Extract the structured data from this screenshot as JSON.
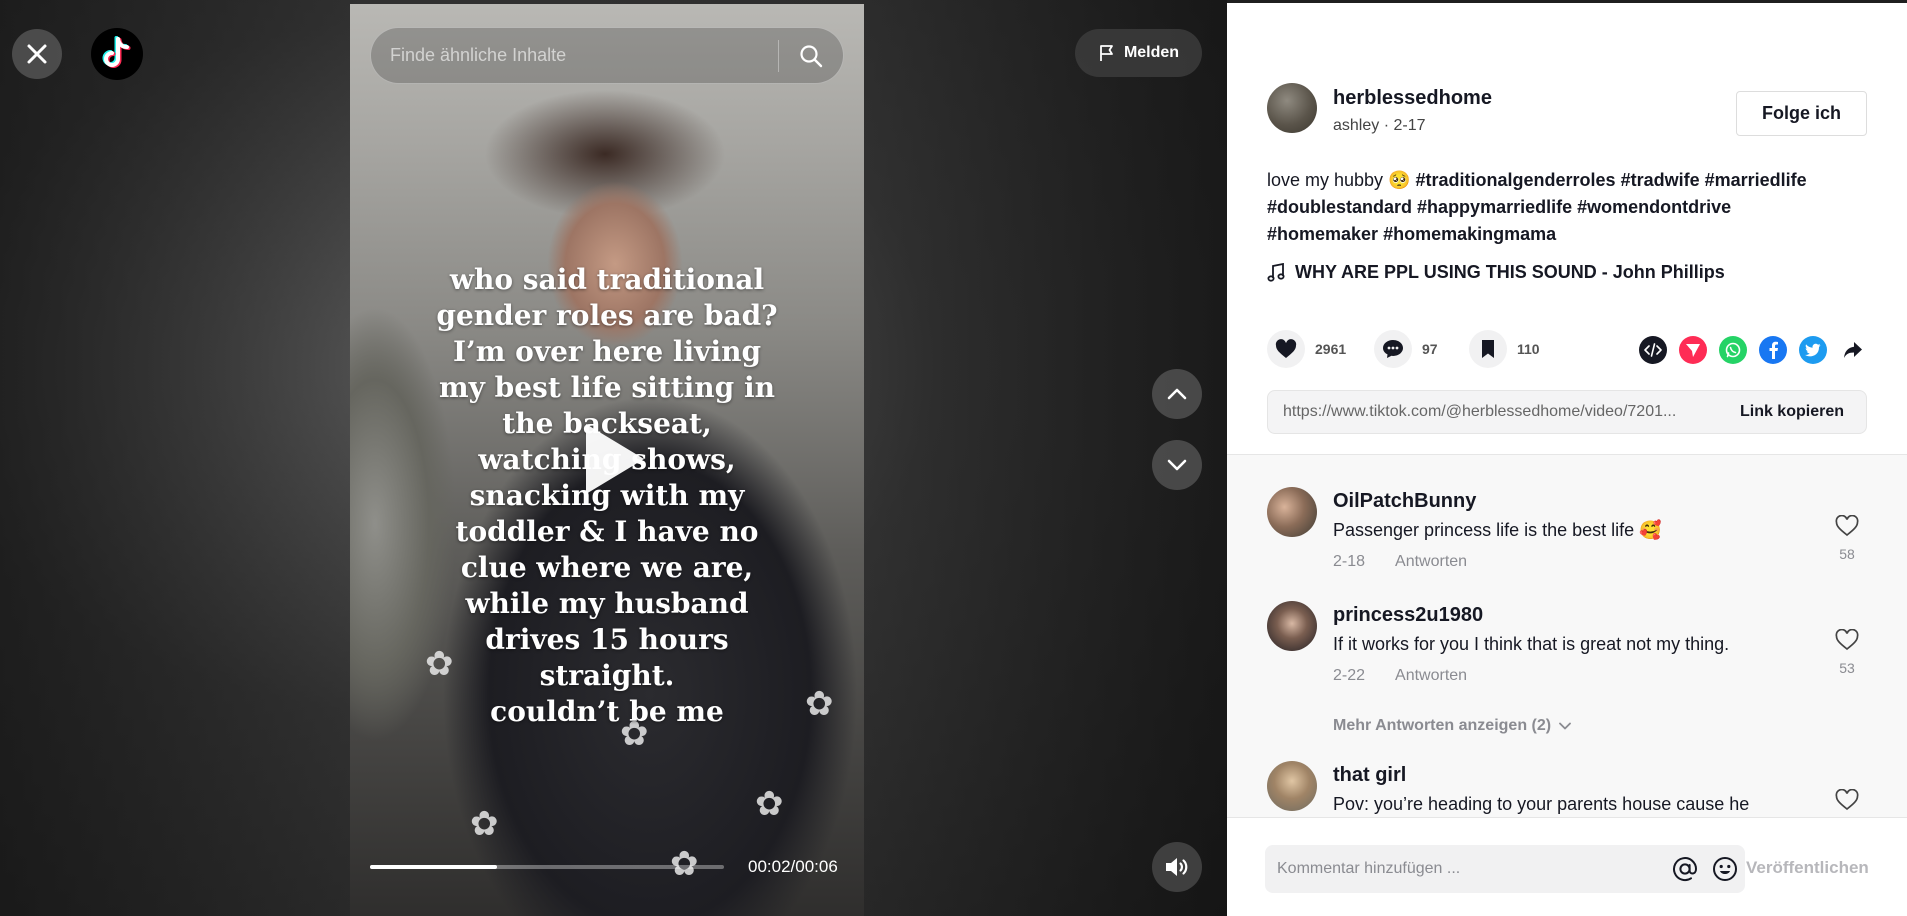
{
  "stage": {
    "search_placeholder": "Finde ähnliche Inhalte",
    "report_label": "Melden",
    "overlay_lines": [
      "who said traditional",
      "gender roles are bad?",
      "I’m over here living",
      "my best life sitting in",
      "the backseat,",
      "watching shows,",
      "snacking with my",
      "toddler & I have no",
      "clue where we are,",
      "while my husband",
      "drives 15 hours",
      "straight.",
      "couldn’t be me"
    ],
    "time_display": "00:02/00:06",
    "progress_fraction": 0.36,
    "icons": [
      "close-icon",
      "tiktok-logo-icon",
      "search-icon",
      "flag-icon",
      "play-icon",
      "chevron-up-icon",
      "chevron-down-icon",
      "volume-icon"
    ]
  },
  "post": {
    "username": "herblessedhome",
    "meta": "ashley · 2-17",
    "follow_label": "Folge ich",
    "description_prefix": "love my hubby 🥺",
    "hashtags": [
      "#traditionalgenderroles",
      "#tradwife",
      "#marriedlife",
      "#doublestandard",
      "#happymarriedlife",
      "#womendontdrive",
      "#homemaker",
      "#homemakingmama"
    ],
    "music": "WHY ARE PPL USING THIS SOUND - John Phillips",
    "likes": "2961",
    "comments": "97",
    "saves": "110",
    "link_url": "https://www.tiktok.com/@herblessedhome/video/7201...",
    "copy_link_label": "Link kopieren",
    "colors": {
      "tiktok_red": "#fe2c55",
      "whatsapp": "#25d366",
      "facebook": "#1877f2",
      "twitter": "#1d9bf0",
      "embed": "#161823"
    }
  },
  "comments": [
    {
      "user": "OilPatchBunny",
      "text": "Passenger princess life is the best life 🥰",
      "date": "2-18",
      "reply_label": "Antworten",
      "likes": "58"
    },
    {
      "user": "princess2u1980",
      "text": "If it works for you I think that is great not my thing.",
      "date": "2-22",
      "reply_label": "Antworten",
      "likes": "53"
    },
    {
      "user": "that girl",
      "text": "Pov: you’re heading to your parents house cause he"
    }
  ],
  "more_replies_label": "Mehr Antworten anzeigen (2)",
  "comment_bar": {
    "placeholder": "Kommentar hinzufügen ...",
    "publish_label": "Veröffentlichen"
  }
}
